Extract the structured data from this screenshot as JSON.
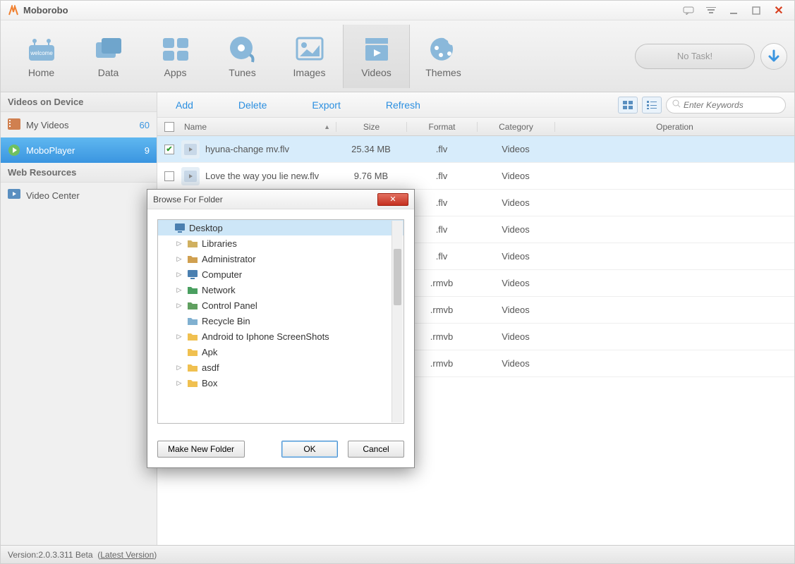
{
  "app": {
    "title": "Moborobo",
    "no_task": "No Task!"
  },
  "titlebar_icons": [
    "chat",
    "menu",
    "min",
    "max",
    "close"
  ],
  "toolbar": [
    {
      "id": "home",
      "label": "Home"
    },
    {
      "id": "data",
      "label": "Data"
    },
    {
      "id": "apps",
      "label": "Apps"
    },
    {
      "id": "tunes",
      "label": "Tunes"
    },
    {
      "id": "images",
      "label": "Images"
    },
    {
      "id": "videos",
      "label": "Videos",
      "active": true
    },
    {
      "id": "themes",
      "label": "Themes"
    }
  ],
  "sidebar": {
    "section1": "Videos on Device",
    "items1": [
      {
        "label": "My Videos",
        "count": "60"
      },
      {
        "label": "MoboPlayer",
        "count": "9",
        "active": true
      }
    ],
    "section2": "Web Resources",
    "items2": [
      {
        "label": "Video Center"
      }
    ]
  },
  "actions": {
    "add": "Add",
    "delete": "Delete",
    "export": "Export",
    "refresh": "Refresh"
  },
  "search": {
    "placeholder": "Enter Keywords"
  },
  "columns": {
    "name": "Name",
    "size": "Size",
    "format": "Format",
    "category": "Category",
    "operation": "Operation"
  },
  "rows": [
    {
      "name": "hyuna-change mv.flv",
      "size": "25.34 MB",
      "format": ".flv",
      "cat": "Videos",
      "checked": true,
      "selected": true
    },
    {
      "name": "Love the way you lie new.flv",
      "size": "9.76 MB",
      "format": ".flv",
      "cat": "Videos"
    },
    {
      "name": "",
      "size": "",
      "format": ".flv",
      "cat": "Videos"
    },
    {
      "name": "",
      "size": "",
      "format": ".flv",
      "cat": "Videos"
    },
    {
      "name": "",
      "size": "",
      "format": ".flv",
      "cat": "Videos"
    },
    {
      "name": "",
      "size": "",
      "format": ".rmvb",
      "cat": "Videos"
    },
    {
      "name": "",
      "size": "",
      "format": ".rmvb",
      "cat": "Videos"
    },
    {
      "name": "",
      "size": "",
      "format": ".rmvb",
      "cat": "Videos"
    },
    {
      "name": "",
      "size": "",
      "format": ".rmvb",
      "cat": "Videos"
    }
  ],
  "status": {
    "version_label": "Version: ",
    "version": "2.0.3.311 Beta",
    "latest": "Latest Version"
  },
  "dialog": {
    "title": "Browse For Folder",
    "make_folder": "Make New Folder",
    "ok": "OK",
    "cancel": "Cancel",
    "tree": [
      {
        "label": "Desktop",
        "indent": 0,
        "selected": true,
        "icon": "desktop"
      },
      {
        "label": "Libraries",
        "indent": 1,
        "arrow": true,
        "icon": "folder-lib"
      },
      {
        "label": "Administrator",
        "indent": 1,
        "arrow": true,
        "icon": "user"
      },
      {
        "label": "Computer",
        "indent": 1,
        "arrow": true,
        "icon": "computer"
      },
      {
        "label": "Network",
        "indent": 1,
        "arrow": true,
        "icon": "network"
      },
      {
        "label": "Control Panel",
        "indent": 1,
        "arrow": true,
        "icon": "control"
      },
      {
        "label": "Recycle Bin",
        "indent": 1,
        "icon": "recycle"
      },
      {
        "label": "Android to Iphone ScreenShots",
        "indent": 1,
        "arrow": true,
        "icon": "folder"
      },
      {
        "label": "Apk",
        "indent": 1,
        "icon": "folder"
      },
      {
        "label": "asdf",
        "indent": 1,
        "arrow": true,
        "icon": "folder"
      },
      {
        "label": "Box",
        "indent": 1,
        "arrow": true,
        "icon": "folder"
      }
    ]
  }
}
